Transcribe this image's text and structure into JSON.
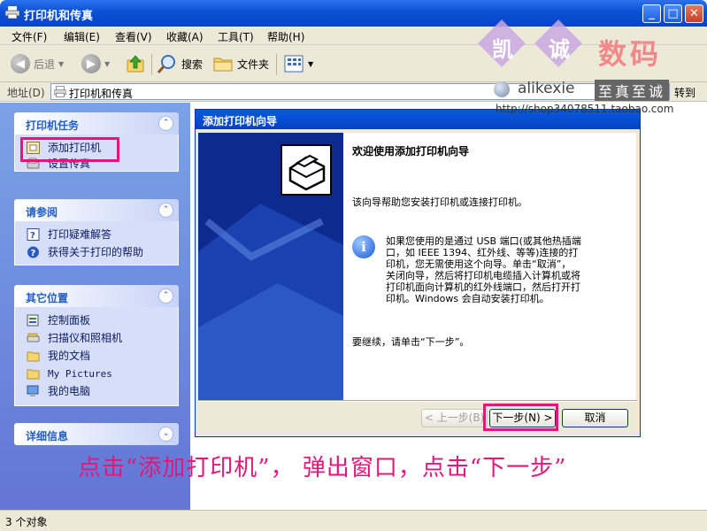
{
  "window": {
    "title": "打印机和传真",
    "controls": {
      "minimize": "_",
      "maximize": "□",
      "close": "✕"
    }
  },
  "menubar": [
    "文件(F)",
    "编辑(E)",
    "查看(V)",
    "收藏(A)",
    "工具(T)",
    "帮助(H)"
  ],
  "toolbar": {
    "back_label": "后退",
    "search_label": "搜索",
    "folders_label": "文件夹"
  },
  "address": {
    "label": "地址(D)",
    "value": "打印机和传真",
    "go_label": "转到"
  },
  "sidebar": {
    "printer_tasks": {
      "title": "打印机任务",
      "items": [
        "添加打印机",
        "设置传真"
      ]
    },
    "see_also": {
      "title": "请参阅",
      "items": [
        "打印疑难解答",
        "获得关于打印的帮助"
      ]
    },
    "other_places": {
      "title": "其它位置",
      "items": [
        "控制面板",
        "扫描仪和照相机",
        "我的文档",
        "My Pictures",
        "我的电脑"
      ]
    },
    "details": {
      "title": "详细信息"
    }
  },
  "status": {
    "text": "3 个对象"
  },
  "wizard": {
    "title": "添加打印机向导",
    "heading": "欢迎使用添加打印机向导",
    "intro": "该向导帮助您安装打印机或连接打印机。",
    "info_lines": [
      "如果您使用的是通过 USB 端口(或其他热插端",
      "口，如 IEEE 1394、红外线、等等)连接的打",
      "印机，您无需使用这个向导。单击“取消”，",
      "关闭向导，然后将打印机电缆插入计算机或将",
      "打印机面向计算机的红外线端口，然后打开打",
      "印机。Windows 会自动安装打印机。"
    ],
    "continue_text": "要继续，请单击“下一步”。",
    "back_button": "< 上一步(B)",
    "next_button": "下一步(N) >",
    "cancel_button": "取消"
  },
  "watermark": {
    "brand_chars": [
      "凯",
      "诚"
    ],
    "brand_suffix": "数码",
    "user": "alikexie",
    "slogan": "至真至诚",
    "url": "http://shop34078511.taobao.com"
  },
  "annotation": {
    "caption": "点击“添加打印机”， 弹出窗口，点击“下一步”",
    "color": "#e2177a"
  },
  "colors": {
    "titlebar": "#0a4fd6",
    "sidebar_gradient": "#6375d6",
    "panel_body": "#d6dff7",
    "panel_title": "#215dc6",
    "highlight": "#e2177a",
    "wizard_side": "#0f2a8e"
  }
}
